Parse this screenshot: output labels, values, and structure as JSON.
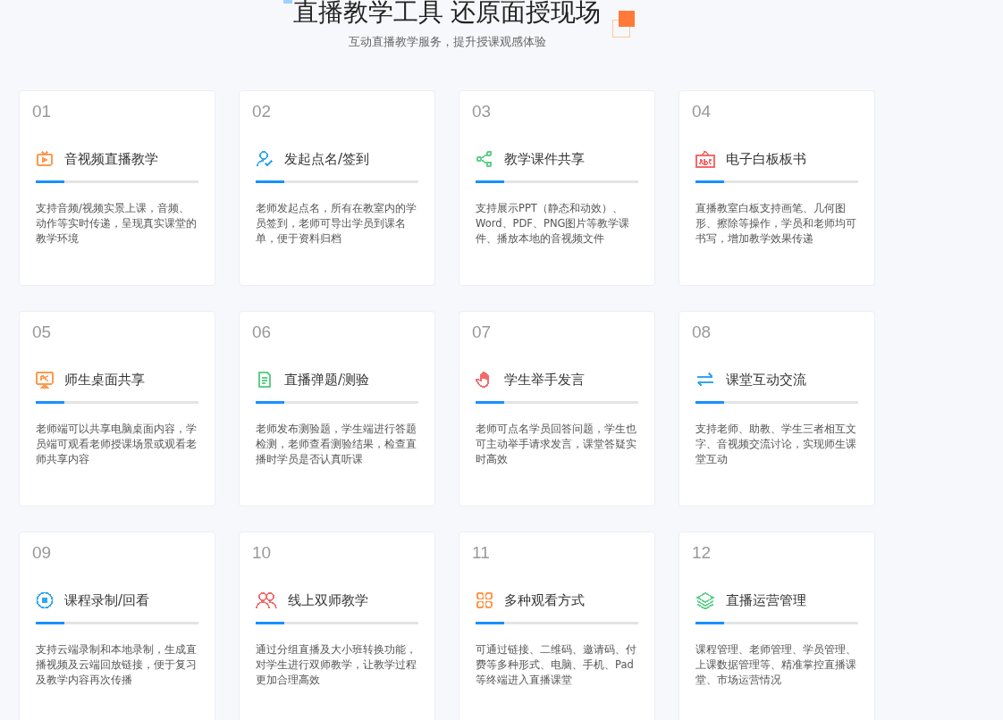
{
  "header": {
    "title": "直播教学工具 还原面授现场",
    "subtitle": "互动直播教学服务，提升授课观感体验"
  },
  "features": [
    {
      "number": "01",
      "title": "音视频直播教学",
      "color": "#ff9a4d",
      "description": "支持音频/视频实景上课，音频、动作等实时传递，呈现真实课堂的教学环境"
    },
    {
      "number": "02",
      "title": "发起点名/签到",
      "color": "#2fa8f0",
      "description": "老师发起点名，所有在教室内的学员签到，老师可导出学员到课名单，便于资料归档"
    },
    {
      "number": "03",
      "title": "教学课件共享",
      "color": "#5fd08a",
      "description": "支持展示PPT（静态和动效）、Word、PDF、PNG图片等教学课件、播放本地的音视频文件"
    },
    {
      "number": "04",
      "title": "电子白板板书",
      "color": "#f46a6a",
      "description": "直播教室白板支持画笔、几何图形、擦除等操作，学员和老师均可书写，增加教学效果传递"
    },
    {
      "number": "05",
      "title": "师生桌面共享",
      "color": "#ff9a4d",
      "description": "老师端可以共享电脑桌面内容，学员端可观看老师授课场景或观看老师共享内容"
    },
    {
      "number": "06",
      "title": "直播弹题/测验",
      "color": "#5fd08a",
      "description": "老师发布测验题，学生端进行答题检测，老师查看测验结果，检查直播时学员是否认真听课"
    },
    {
      "number": "07",
      "title": "学生举手发言",
      "color": "#f46a6a",
      "description": "老师可点名学员回答问题，学生也可主动举手请求发言，课堂答疑实时高效"
    },
    {
      "number": "08",
      "title": "课堂互动交流",
      "color": "#2fa8f0",
      "description": "支持老师、助教、学生三者相互文字、音视频交流讨论，实现师生课堂互动"
    },
    {
      "number": "09",
      "title": "课程录制/回看",
      "color": "#2fa8f0",
      "description": "支持云端录制和本地录制，生成直播视频及云端回放链接，便于复习及教学内容再次传播"
    },
    {
      "number": "10",
      "title": "线上双师教学",
      "color": "#f46a6a",
      "description": "通过分组直播及大小班转换功能，对学生进行双师教学，让教学过程更加合理高效"
    },
    {
      "number": "11",
      "title": "多种观看方式",
      "color": "#ff9a4d",
      "description": "可通过链接、二维码、邀请码、付费等多种形式、电脑、手机、Pad等终端进入直播课堂"
    },
    {
      "number": "12",
      "title": "直播运营管理",
      "color": "#5fd08a",
      "description": "课程管理、老师管理、学员管理、上课数据管理等、精准掌控直播课堂、市场运营情况"
    }
  ]
}
